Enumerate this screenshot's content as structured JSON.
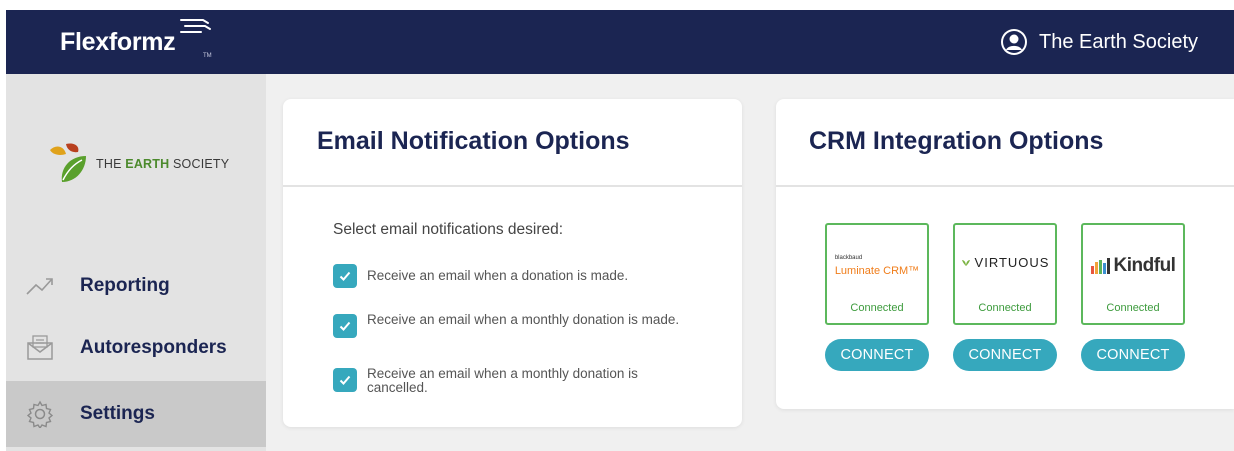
{
  "brand": {
    "name": "Flexformz",
    "tm": "TM"
  },
  "account": {
    "name": "The Earth Society",
    "icon": "user-circle-icon"
  },
  "organization": {
    "name_part1": "THE ",
    "name_part2": "EARTH",
    "name_part3": " SOCIETY",
    "logo_icon": "leaf-logo-icon"
  },
  "sidebar": {
    "items": [
      {
        "label": "Reporting",
        "icon": "trend-line-icon"
      },
      {
        "label": "Autoresponders",
        "icon": "envelope-icon"
      },
      {
        "label": "Settings",
        "icon": "gear-icon",
        "active": true
      }
    ]
  },
  "email_card": {
    "title": "Email Notification Options",
    "prompt": "Select email notifications desired:",
    "options": [
      {
        "label": "Receive an email when a donation is made.",
        "checked": true
      },
      {
        "label": "Receive an email when a monthly donation is made.",
        "checked": true
      },
      {
        "label": "Receive an email when a monthly donation is cancelled.",
        "checked": true
      }
    ]
  },
  "crm_card": {
    "title": "CRM Integration Options",
    "integrations": [
      {
        "logo_small": "blackbaud",
        "logo_main": "Luminate CRM™",
        "status": "Connected",
        "button": "CONNECT"
      },
      {
        "logo_main": "VIRTUOUS",
        "status": "Connected",
        "button": "CONNECT"
      },
      {
        "logo_main": "Kindful",
        "status": "Connected",
        "button": "CONNECT"
      }
    ]
  },
  "colors": {
    "navy": "#1b2552",
    "teal": "#36a8bd",
    "connected_green": "#5cb85c",
    "luminate_orange": "#f07d1a"
  }
}
